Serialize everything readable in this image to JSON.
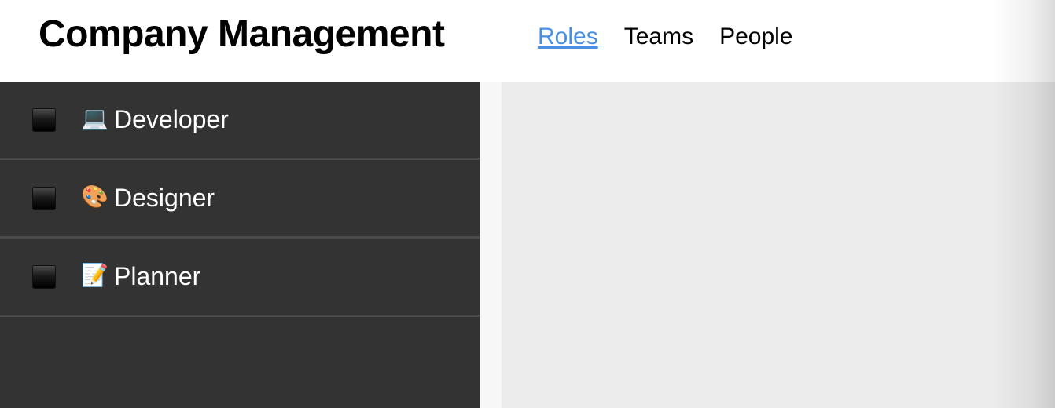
{
  "header": {
    "title": "Company Management",
    "nav": [
      {
        "label": "Roles",
        "active": true
      },
      {
        "label": "Teams",
        "active": false
      },
      {
        "label": "People",
        "active": false
      }
    ]
  },
  "sidebar": {
    "roles": [
      {
        "emoji": "💻",
        "emoji_icon": "laptop-icon",
        "label": "Developer",
        "checked": false
      },
      {
        "emoji": "🎨",
        "emoji_icon": "palette-icon",
        "label": "Designer",
        "checked": false
      },
      {
        "emoji": "📝",
        "emoji_icon": "memo-icon",
        "label": "Planner",
        "checked": false
      }
    ]
  },
  "colors": {
    "nav_active": "#4a90e2",
    "sidebar_bg": "#333333",
    "main_bg": "#ececec"
  }
}
